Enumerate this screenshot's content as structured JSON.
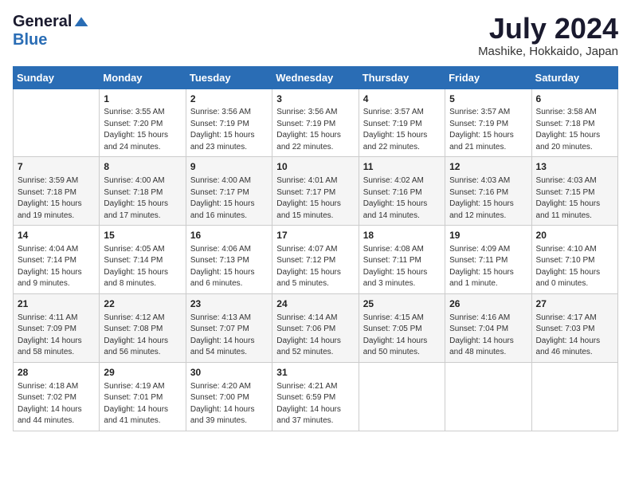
{
  "header": {
    "logo_general": "General",
    "logo_blue": "Blue",
    "month_title": "July 2024",
    "location": "Mashike, Hokkaido, Japan"
  },
  "days_of_week": [
    "Sunday",
    "Monday",
    "Tuesday",
    "Wednesday",
    "Thursday",
    "Friday",
    "Saturday"
  ],
  "weeks": [
    [
      {
        "day": "",
        "sunrise": "",
        "sunset": "",
        "daylight": ""
      },
      {
        "day": "1",
        "sunrise": "Sunrise: 3:55 AM",
        "sunset": "Sunset: 7:20 PM",
        "daylight": "Daylight: 15 hours and 24 minutes."
      },
      {
        "day": "2",
        "sunrise": "Sunrise: 3:56 AM",
        "sunset": "Sunset: 7:19 PM",
        "daylight": "Daylight: 15 hours and 23 minutes."
      },
      {
        "day": "3",
        "sunrise": "Sunrise: 3:56 AM",
        "sunset": "Sunset: 7:19 PM",
        "daylight": "Daylight: 15 hours and 22 minutes."
      },
      {
        "day": "4",
        "sunrise": "Sunrise: 3:57 AM",
        "sunset": "Sunset: 7:19 PM",
        "daylight": "Daylight: 15 hours and 22 minutes."
      },
      {
        "day": "5",
        "sunrise": "Sunrise: 3:57 AM",
        "sunset": "Sunset: 7:19 PM",
        "daylight": "Daylight: 15 hours and 21 minutes."
      },
      {
        "day": "6",
        "sunrise": "Sunrise: 3:58 AM",
        "sunset": "Sunset: 7:18 PM",
        "daylight": "Daylight: 15 hours and 20 minutes."
      }
    ],
    [
      {
        "day": "7",
        "sunrise": "Sunrise: 3:59 AM",
        "sunset": "Sunset: 7:18 PM",
        "daylight": "Daylight: 15 hours and 19 minutes."
      },
      {
        "day": "8",
        "sunrise": "Sunrise: 4:00 AM",
        "sunset": "Sunset: 7:18 PM",
        "daylight": "Daylight: 15 hours and 17 minutes."
      },
      {
        "day": "9",
        "sunrise": "Sunrise: 4:00 AM",
        "sunset": "Sunset: 7:17 PM",
        "daylight": "Daylight: 15 hours and 16 minutes."
      },
      {
        "day": "10",
        "sunrise": "Sunrise: 4:01 AM",
        "sunset": "Sunset: 7:17 PM",
        "daylight": "Daylight: 15 hours and 15 minutes."
      },
      {
        "day": "11",
        "sunrise": "Sunrise: 4:02 AM",
        "sunset": "Sunset: 7:16 PM",
        "daylight": "Daylight: 15 hours and 14 minutes."
      },
      {
        "day": "12",
        "sunrise": "Sunrise: 4:03 AM",
        "sunset": "Sunset: 7:16 PM",
        "daylight": "Daylight: 15 hours and 12 minutes."
      },
      {
        "day": "13",
        "sunrise": "Sunrise: 4:03 AM",
        "sunset": "Sunset: 7:15 PM",
        "daylight": "Daylight: 15 hours and 11 minutes."
      }
    ],
    [
      {
        "day": "14",
        "sunrise": "Sunrise: 4:04 AM",
        "sunset": "Sunset: 7:14 PM",
        "daylight": "Daylight: 15 hours and 9 minutes."
      },
      {
        "day": "15",
        "sunrise": "Sunrise: 4:05 AM",
        "sunset": "Sunset: 7:14 PM",
        "daylight": "Daylight: 15 hours and 8 minutes."
      },
      {
        "day": "16",
        "sunrise": "Sunrise: 4:06 AM",
        "sunset": "Sunset: 7:13 PM",
        "daylight": "Daylight: 15 hours and 6 minutes."
      },
      {
        "day": "17",
        "sunrise": "Sunrise: 4:07 AM",
        "sunset": "Sunset: 7:12 PM",
        "daylight": "Daylight: 15 hours and 5 minutes."
      },
      {
        "day": "18",
        "sunrise": "Sunrise: 4:08 AM",
        "sunset": "Sunset: 7:11 PM",
        "daylight": "Daylight: 15 hours and 3 minutes."
      },
      {
        "day": "19",
        "sunrise": "Sunrise: 4:09 AM",
        "sunset": "Sunset: 7:11 PM",
        "daylight": "Daylight: 15 hours and 1 minute."
      },
      {
        "day": "20",
        "sunrise": "Sunrise: 4:10 AM",
        "sunset": "Sunset: 7:10 PM",
        "daylight": "Daylight: 15 hours and 0 minutes."
      }
    ],
    [
      {
        "day": "21",
        "sunrise": "Sunrise: 4:11 AM",
        "sunset": "Sunset: 7:09 PM",
        "daylight": "Daylight: 14 hours and 58 minutes."
      },
      {
        "day": "22",
        "sunrise": "Sunrise: 4:12 AM",
        "sunset": "Sunset: 7:08 PM",
        "daylight": "Daylight: 14 hours and 56 minutes."
      },
      {
        "day": "23",
        "sunrise": "Sunrise: 4:13 AM",
        "sunset": "Sunset: 7:07 PM",
        "daylight": "Daylight: 14 hours and 54 minutes."
      },
      {
        "day": "24",
        "sunrise": "Sunrise: 4:14 AM",
        "sunset": "Sunset: 7:06 PM",
        "daylight": "Daylight: 14 hours and 52 minutes."
      },
      {
        "day": "25",
        "sunrise": "Sunrise: 4:15 AM",
        "sunset": "Sunset: 7:05 PM",
        "daylight": "Daylight: 14 hours and 50 minutes."
      },
      {
        "day": "26",
        "sunrise": "Sunrise: 4:16 AM",
        "sunset": "Sunset: 7:04 PM",
        "daylight": "Daylight: 14 hours and 48 minutes."
      },
      {
        "day": "27",
        "sunrise": "Sunrise: 4:17 AM",
        "sunset": "Sunset: 7:03 PM",
        "daylight": "Daylight: 14 hours and 46 minutes."
      }
    ],
    [
      {
        "day": "28",
        "sunrise": "Sunrise: 4:18 AM",
        "sunset": "Sunset: 7:02 PM",
        "daylight": "Daylight: 14 hours and 44 minutes."
      },
      {
        "day": "29",
        "sunrise": "Sunrise: 4:19 AM",
        "sunset": "Sunset: 7:01 PM",
        "daylight": "Daylight: 14 hours and 41 minutes."
      },
      {
        "day": "30",
        "sunrise": "Sunrise: 4:20 AM",
        "sunset": "Sunset: 7:00 PM",
        "daylight": "Daylight: 14 hours and 39 minutes."
      },
      {
        "day": "31",
        "sunrise": "Sunrise: 4:21 AM",
        "sunset": "Sunset: 6:59 PM",
        "daylight": "Daylight: 14 hours and 37 minutes."
      },
      {
        "day": "",
        "sunrise": "",
        "sunset": "",
        "daylight": ""
      },
      {
        "day": "",
        "sunrise": "",
        "sunset": "",
        "daylight": ""
      },
      {
        "day": "",
        "sunrise": "",
        "sunset": "",
        "daylight": ""
      }
    ]
  ]
}
